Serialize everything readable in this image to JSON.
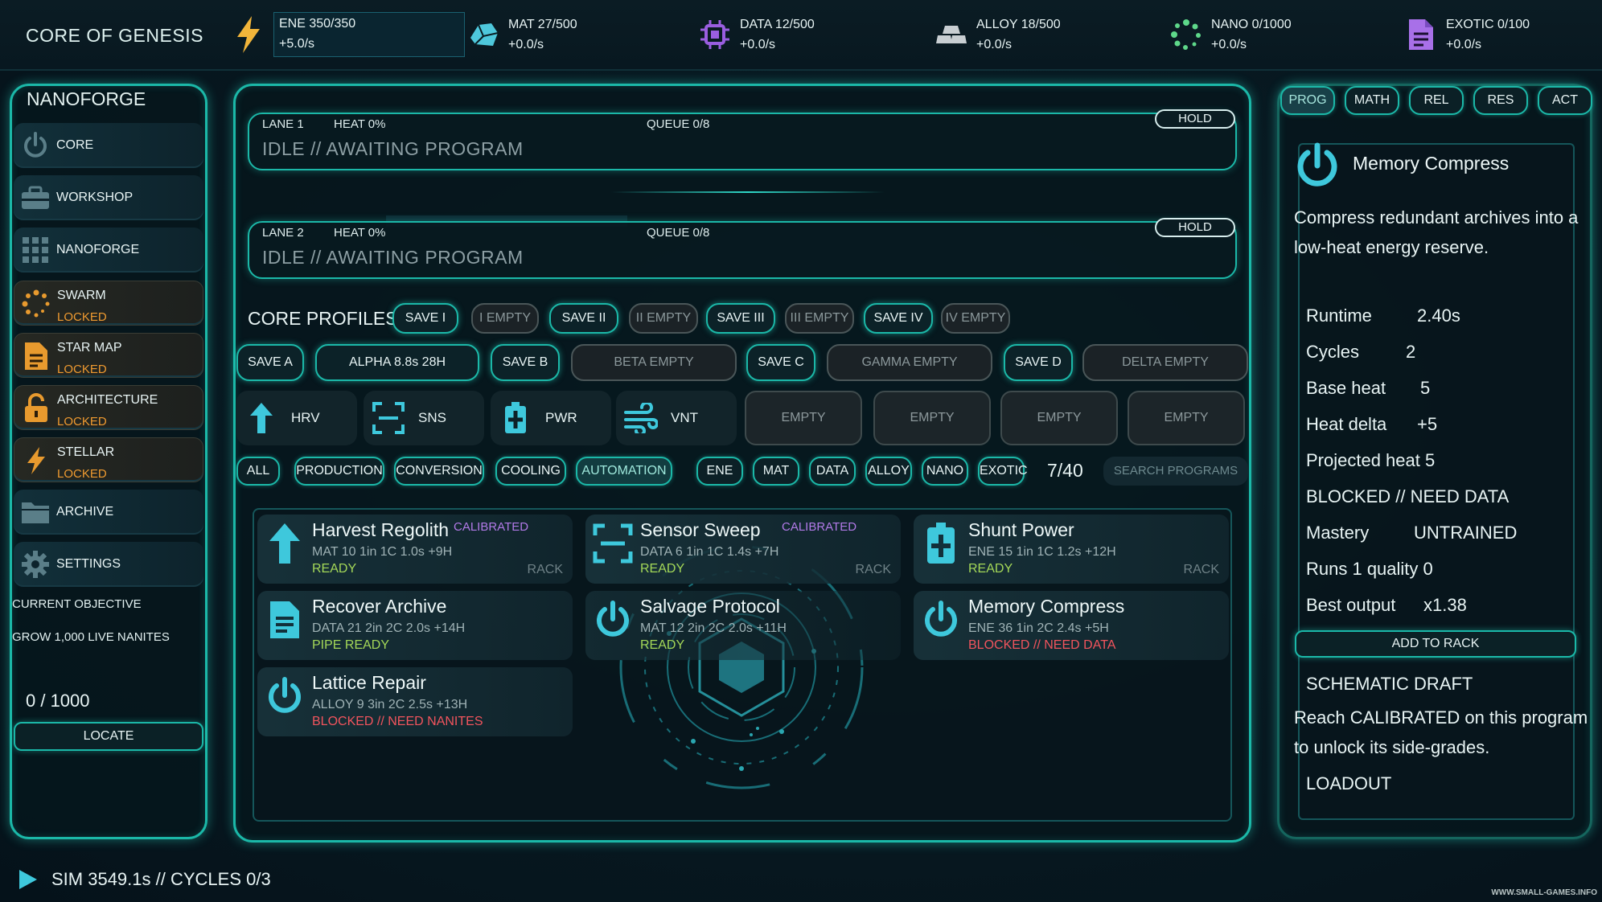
{
  "game_title": "CORE OF GENESIS",
  "resources": [
    {
      "line1": "ENE 350/350",
      "line2": "+5.0/s",
      "icon": "bolt-icon",
      "color": "#f2b53a"
    },
    {
      "line1": "MAT 27/500",
      "line2": "+0.0/s",
      "icon": "rock-icon",
      "color": "#4ec8dc"
    },
    {
      "line1": "DATA 12/500",
      "line2": "+0.0/s",
      "icon": "chip-icon",
      "color": "#9a5ee0"
    },
    {
      "line1": "ALLOY 18/500",
      "line2": "+0.0/s",
      "icon": "ingot-icon",
      "color": "#c8ced2"
    },
    {
      "line1": "NANO 0/1000",
      "line2": "+0.0/s",
      "icon": "particles-icon",
      "color": "#5ed88a"
    },
    {
      "line1": "EXOTIC 0/100",
      "line2": "+0.0/s",
      "icon": "document-icon",
      "color": "#a870e8"
    }
  ],
  "nav": {
    "title": "NANOFORGE",
    "items": [
      {
        "label": "CORE",
        "icon": "power-icon"
      },
      {
        "label": "WORKSHOP",
        "icon": "toolbox-icon"
      },
      {
        "label": "NANOFORGE",
        "icon": "grid-icon"
      },
      {
        "label": "SWARM",
        "icon": "swarm-icon",
        "status": "LOCKED"
      },
      {
        "label": "STAR MAP",
        "icon": "map-document-icon",
        "status": "LOCKED"
      },
      {
        "label": "ARCHITECTURE",
        "icon": "lock-icon",
        "status": "LOCKED"
      },
      {
        "label": "STELLAR",
        "icon": "bolt-icon",
        "status": "LOCKED"
      },
      {
        "label": "ARCHIVE",
        "icon": "folder-icon"
      },
      {
        "label": "SETTINGS",
        "icon": "gear-icon"
      }
    ]
  },
  "objective": {
    "heading": "CURRENT OBJECTIVE",
    "text": "GROW 1,000 LIVE NANITES",
    "progress": "0 / 1000",
    "button": "LOCATE"
  },
  "lanes": [
    {
      "name": "LANE 1",
      "heat": "HEAT 0%",
      "queue": "QUEUE 0/8",
      "status": "IDLE // AWAITING PROGRAM",
      "hold": "HOLD"
    },
    {
      "name": "LANE 2",
      "heat": "HEAT 0%",
      "queue": "QUEUE 0/8",
      "status": "IDLE // AWAITING PROGRAM",
      "hold": "HOLD"
    }
  ],
  "profiles": {
    "title": "CORE PROFILES",
    "row1": [
      "SAVE I",
      "I EMPTY",
      "SAVE II",
      "II EMPTY",
      "SAVE III",
      "III EMPTY",
      "SAVE IV",
      "IV EMPTY"
    ],
    "row2": [
      "SAVE A",
      "ALPHA 8.8s 28H",
      "SAVE B",
      "BETA EMPTY",
      "SAVE C",
      "GAMMA EMPTY",
      "SAVE D",
      "DELTA EMPTY"
    ]
  },
  "hotbar": [
    {
      "label": "HRV",
      "icon": "arrow-up-icon"
    },
    {
      "label": "SNS",
      "icon": "scan-icon"
    },
    {
      "label": "PWR",
      "icon": "battery-icon"
    },
    {
      "label": "VNT",
      "icon": "wind-icon"
    }
  ],
  "hotbar_empty": [
    "EMPTY",
    "EMPTY",
    "EMPTY",
    "EMPTY"
  ],
  "filters": {
    "categories": [
      "ALL",
      "PRODUCTION",
      "CONVERSION",
      "COOLING",
      "AUTOMATION"
    ],
    "resources": [
      "ENE",
      "MAT",
      "DATA",
      "ALLOY",
      "NANO",
      "EXOTIC"
    ],
    "count": "7/40",
    "search_placeholder": "SEARCH PROGRAMS"
  },
  "programs": [
    {
      "name": "Harvest Regolith",
      "badge": "CALIBRATED",
      "stats": "MAT 10  1in  1C  1.0s  +9H",
      "status": "READY",
      "rack": "RACK",
      "icon": "arrow-up-icon"
    },
    {
      "name": "Sensor Sweep",
      "badge": "CALIBRATED",
      "stats": "DATA 6  1in  1C  1.4s  +7H",
      "status": "READY",
      "rack": "RACK",
      "icon": "scan-icon"
    },
    {
      "name": "Shunt Power",
      "badge": "",
      "stats": "ENE 15  1in  1C  1.2s  +12H",
      "status": "READY",
      "rack": "RACK",
      "icon": "battery-icon"
    },
    {
      "name": "Recover Archive",
      "badge": "",
      "stats": "DATA 21  2in  2C  2.0s  +14H",
      "status": "PIPE READY",
      "rack": "",
      "icon": "document-icon"
    },
    {
      "name": "Salvage Protocol",
      "badge": "",
      "stats": "MAT 12  2in  2C  2.0s  +11H",
      "status": "READY",
      "rack": "",
      "icon": "power-icon"
    },
    {
      "name": "Memory Compress",
      "badge": "",
      "stats": "ENE 36  1in  2C  2.4s  +5H",
      "status": "BLOCKED // NEED DATA",
      "rack": "",
      "icon": "power-icon"
    },
    {
      "name": "Lattice Repair",
      "badge": "",
      "stats": "ALLOY 9  3in  2C  2.5s  +13H",
      "status": "BLOCKED // NEED NANITES",
      "rack": "",
      "icon": "power-icon"
    }
  ],
  "tabs": [
    "PROG",
    "MATH",
    "REL",
    "RES",
    "ACT"
  ],
  "detail": {
    "title": "Memory Compress",
    "description": "Compress redundant archives into a low-heat energy reserve.",
    "stats": [
      {
        "k": "Runtime",
        "v": "2.40s"
      },
      {
        "k": "Cycles",
        "v": "2"
      },
      {
        "k": "Base heat",
        "v": "5"
      },
      {
        "k": "Heat delta",
        "v": "+5"
      },
      {
        "k": "Projected heat 5",
        "v": ""
      },
      {
        "k": "BLOCKED // NEED DATA",
        "v": ""
      },
      {
        "k": "Mastery",
        "v": "UNTRAINED"
      },
      {
        "k": "Runs 1  quality 0",
        "v": ""
      },
      {
        "k": "Best output",
        "v": "x1.38"
      }
    ],
    "button": "ADD TO RACK",
    "schematic_title": "SCHEMATIC DRAFT",
    "schematic_text": "Reach CALIBRATED on this program to unlock its side-grades.",
    "loadout": "LOADOUT"
  },
  "footer": {
    "sim": "SIM 3549.1s // CYCLES 0/3"
  },
  "watermark": "WWW.SMALL-GAMES.INFO"
}
